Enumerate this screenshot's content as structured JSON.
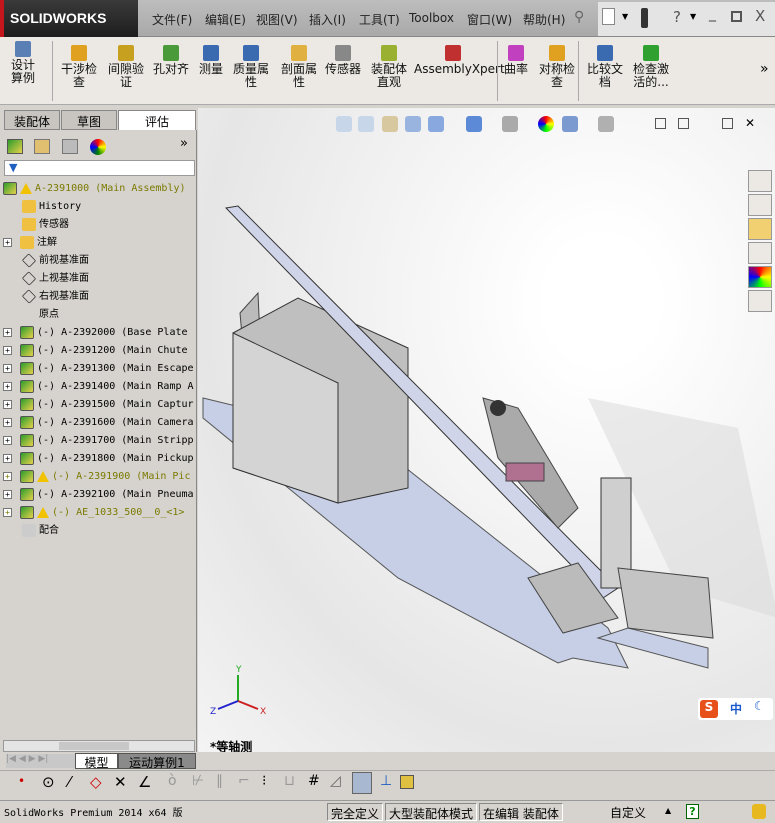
{
  "app": {
    "logo": "SOLIDWORKS"
  },
  "menu": [
    "文件(F)",
    "编辑(E)",
    "视图(V)",
    "插入(I)",
    "工具(T)",
    "Toolbox",
    "窗口(W)",
    "帮助(H)"
  ],
  "command_manager": [
    {
      "label": "设计算例",
      "icon": "design-study-icon",
      "color": "#5a7fb5"
    },
    {
      "label": "干涉检查",
      "icon": "interference-icon",
      "color": "#e0a020"
    },
    {
      "label": "间隙验证",
      "icon": "clearance-icon",
      "color": "#c8a020"
    },
    {
      "label": "孔对齐",
      "icon": "hole-align-icon",
      "color": "#4a9a3a"
    },
    {
      "label": "测量",
      "icon": "measure-icon",
      "color": "#3a6ab0"
    },
    {
      "label": "质量属性",
      "icon": "mass-props-icon",
      "color": "#3a6ab0"
    },
    {
      "label": "剖面属性",
      "icon": "section-props-icon",
      "color": "#e0b040"
    },
    {
      "label": "传感器",
      "icon": "sensor-icon",
      "color": "#888888"
    },
    {
      "label": "装配体直观",
      "icon": "asm-visual-icon",
      "color": "#9ab030"
    },
    {
      "label": "AssemblyXpert",
      "icon": "assemblyxpert-icon",
      "color": "#c03030"
    },
    {
      "label": "曲率",
      "icon": "curvature-icon",
      "color": "#c040c0"
    },
    {
      "label": "对称检查",
      "icon": "symmetry-icon",
      "color": "#e0a020"
    },
    {
      "label": "比较文档",
      "icon": "compare-icon",
      "color": "#3a6ab0"
    },
    {
      "label": "检查激活的...",
      "icon": "check-active-icon",
      "color": "#30a030"
    }
  ],
  "panel_tabs": [
    "装配体",
    "草图",
    "评估"
  ],
  "active_panel_tab": "评估",
  "tree": {
    "root": "A-2391000 (Main Assembly)",
    "items": [
      {
        "label": "History",
        "type": "history",
        "expand": false
      },
      {
        "label": "传感器",
        "type": "sensor",
        "expand": false
      },
      {
        "label": "注解",
        "type": "annotation",
        "expand": true
      },
      {
        "label": "前视基准面",
        "type": "plane",
        "expand": false
      },
      {
        "label": "上视基准面",
        "type": "plane",
        "expand": false
      },
      {
        "label": "右视基准面",
        "type": "plane",
        "expand": false
      },
      {
        "label": "原点",
        "type": "origin",
        "expand": false
      },
      {
        "label": "(-) A-2392000 (Base Plate",
        "type": "asm",
        "expand": true
      },
      {
        "label": "(-) A-2391200 (Main Chute",
        "type": "asm",
        "expand": true
      },
      {
        "label": "(-) A-2391300 (Main Escape",
        "type": "asm",
        "expand": true
      },
      {
        "label": "(-) A-2391400 (Main Ramp A",
        "type": "asm",
        "expand": true
      },
      {
        "label": "(-) A-2391500 (Main Captur",
        "type": "asm",
        "expand": true
      },
      {
        "label": "(-) A-2391600 (Main Camera",
        "type": "asm",
        "expand": true
      },
      {
        "label": "(-) A-2391700 (Main Stripp",
        "type": "asm",
        "expand": true
      },
      {
        "label": "(-) A-2391800 (Main Pickup",
        "type": "asm",
        "expand": true
      },
      {
        "label": "(-) A-2391900 (Main Pic",
        "type": "asm-warn",
        "expand": true
      },
      {
        "label": "(-) A-2392100 (Main Pneuma",
        "type": "asm",
        "expand": true
      },
      {
        "label": "(-) AE_1033_500__0_<1>",
        "type": "asm-warn",
        "expand": true
      },
      {
        "label": "配合",
        "type": "mates",
        "expand": false
      }
    ]
  },
  "viewport": {
    "view_name": "*等轴测",
    "triad": [
      "Y",
      "X",
      "Z"
    ],
    "ime": [
      "中"
    ]
  },
  "bottom_tabs": [
    "模型",
    "运动算例1"
  ],
  "status": {
    "product": "SolidWorks Premium 2014 x64 版",
    "cells": [
      "完全定义",
      "大型装配体模式",
      "在编辑 装配体",
      "自定义"
    ]
  }
}
